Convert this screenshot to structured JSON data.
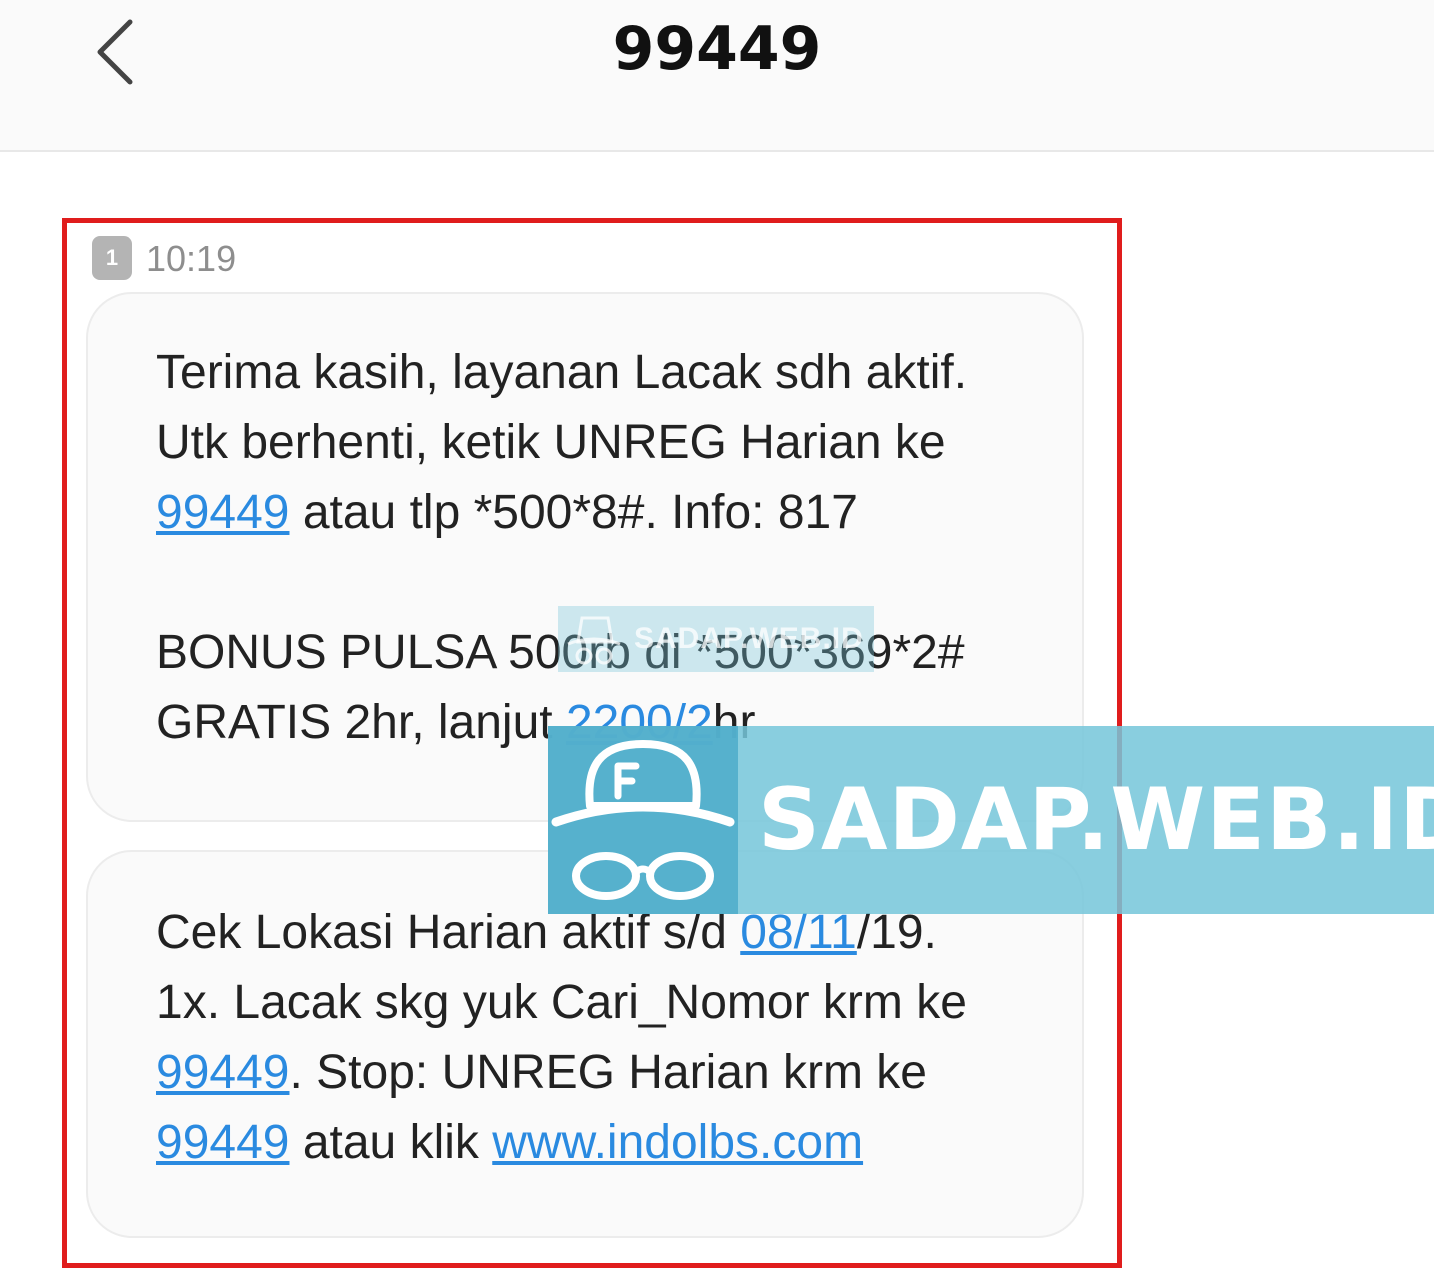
{
  "header": {
    "title": "99449",
    "back_icon": "chevron-left-icon"
  },
  "message_group": {
    "sim_label": "1",
    "time": "10:19"
  },
  "messages": [
    {
      "lines": [
        [
          {
            "t": "Terima kasih, layanan Lacak sdh aktif."
          }
        ],
        [
          {
            "t": "Utk berhenti, ketik UNREG Harian ke"
          }
        ],
        [
          {
            "t": "99449",
            "link": true
          },
          {
            "t": " atau tlp *500*8#. Info: 817"
          }
        ],
        [
          {
            "t": ""
          }
        ],
        [
          {
            "t": "BONUS PULSA 500rb di *500*369*2#"
          }
        ],
        [
          {
            "t": "GRATIS 2hr, lanjut "
          },
          {
            "t": "2200/2",
            "link": true
          },
          {
            "t": "hr"
          }
        ]
      ]
    },
    {
      "lines": [
        [
          {
            "t": "Cek Lokasi Harian aktif s/d "
          },
          {
            "t": "08/11",
            "link": true
          },
          {
            "t": "/19."
          }
        ],
        [
          {
            "t": "1x. Lacak skg yuk Cari_Nomor krm ke"
          }
        ],
        [
          {
            "t": "99449",
            "link": true
          },
          {
            "t": ". Stop: UNREG Harian krm ke"
          }
        ],
        [
          {
            "t": "99449",
            "link": true
          },
          {
            "t": " atau klik "
          },
          {
            "t": "www.indolbs.com",
            "link": true
          }
        ]
      ]
    }
  ],
  "watermark": {
    "text": "SADAP.WEB.ID",
    "icon": "spy-hat-glasses-icon"
  },
  "colors": {
    "link": "#2a8ae0",
    "highlight_border": "#e01d1d",
    "watermark_bg": "#76c6da"
  }
}
